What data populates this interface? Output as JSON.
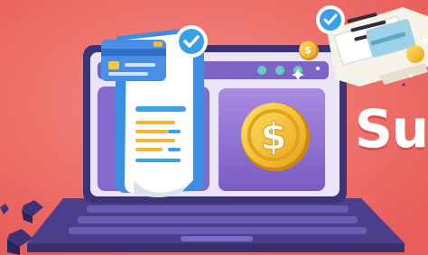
{
  "headline": "Su",
  "colors": {
    "background": "#ee6b66",
    "laptop_body": "#5a4e9a",
    "screen": "#8b6fc9",
    "coin": "#f4c430",
    "check": "#3aa0e8"
  },
  "icons": [
    "laptop",
    "receipt",
    "credit-card",
    "check-badge",
    "dollar-coin",
    "envelope",
    "cubes"
  ]
}
